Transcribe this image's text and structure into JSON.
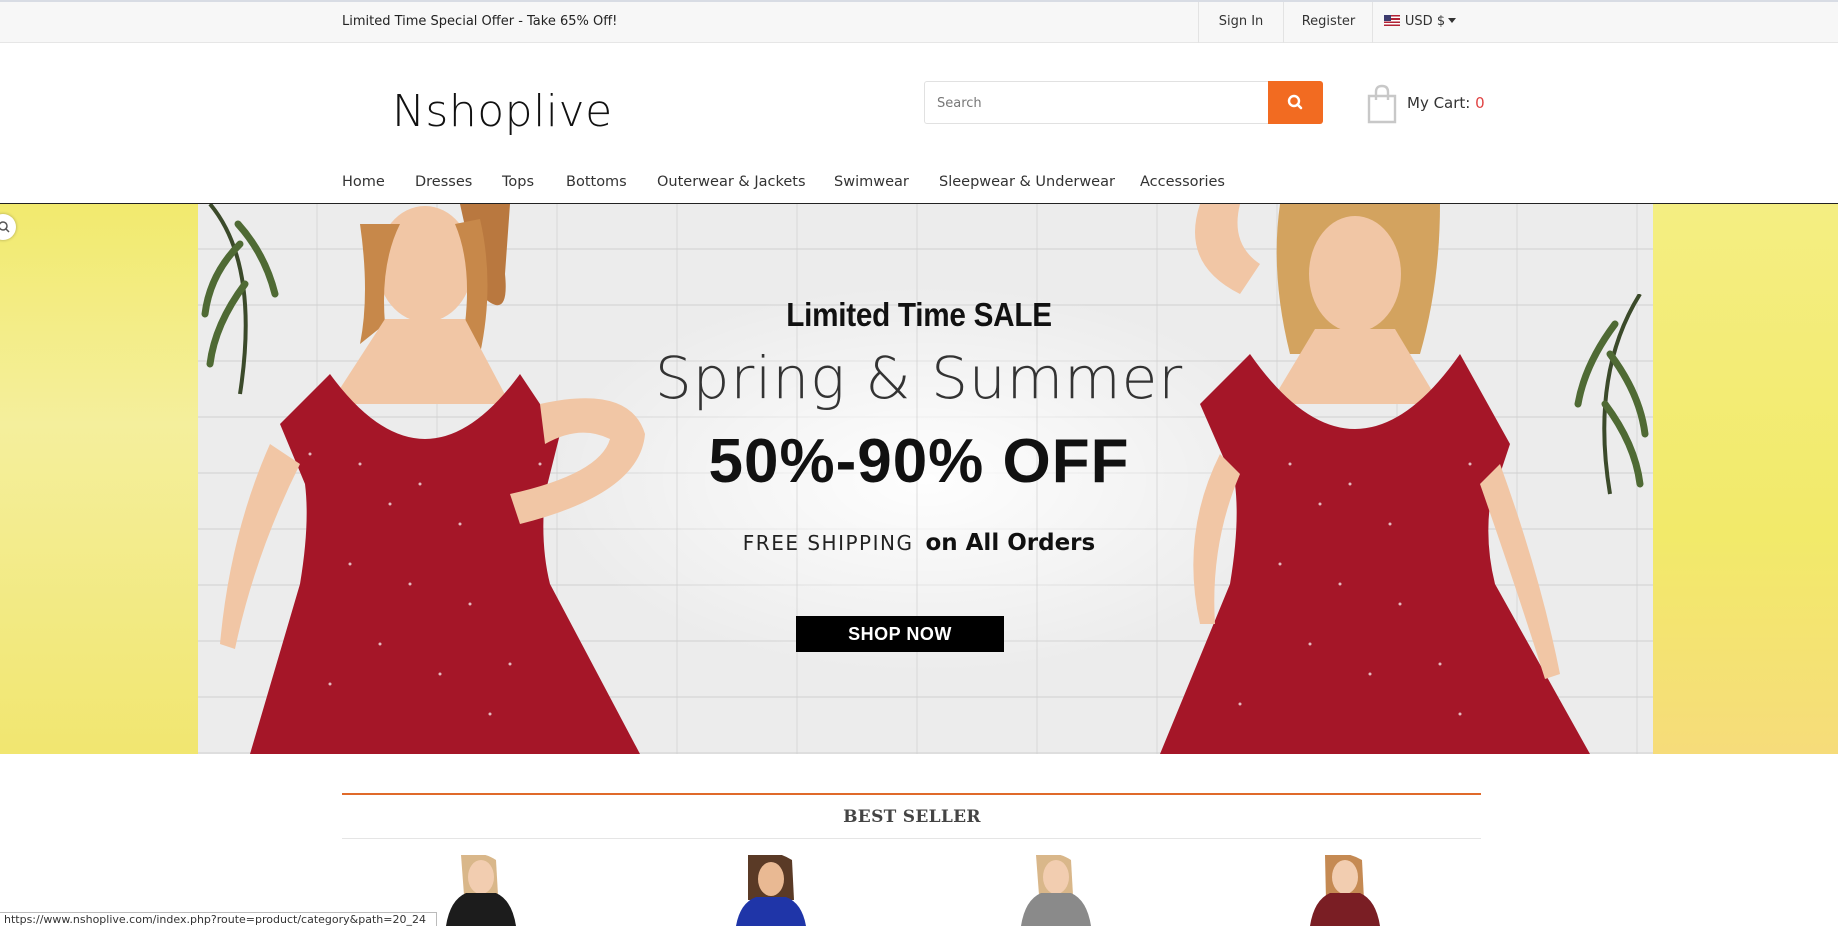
{
  "topbar": {
    "promo": "Limited Time Special Offer - Take 65% Off!",
    "sign_in": "Sign In",
    "register": "Register",
    "currency": "USD $"
  },
  "header": {
    "logo": "Nshoplive",
    "search_placeholder": "Search",
    "cart_label": "My Cart:",
    "cart_count": "0"
  },
  "nav": {
    "items": [
      "Home",
      "Dresses",
      "Tops",
      "Bottoms",
      "Outerwear & Jackets",
      "Swimwear",
      "Sleepwear & Underwear",
      "Accessories"
    ]
  },
  "banner": {
    "title": "Limited Time SALE",
    "subtitle": "Spring & Summer",
    "discount": "50%-90% OFF",
    "shipping_a": "FREE SHIPPING",
    "shipping_b": "on All Orders",
    "cta": "SHOP NOW"
  },
  "best_seller": {
    "title": "BEST SELLER",
    "product_colors": [
      "#1c1c1c",
      "#1f35a8",
      "#8a8a8a",
      "#7a1e24"
    ]
  },
  "status_bar": "https://www.nshoplive.com/index.php?route=product/category&path=20_24"
}
